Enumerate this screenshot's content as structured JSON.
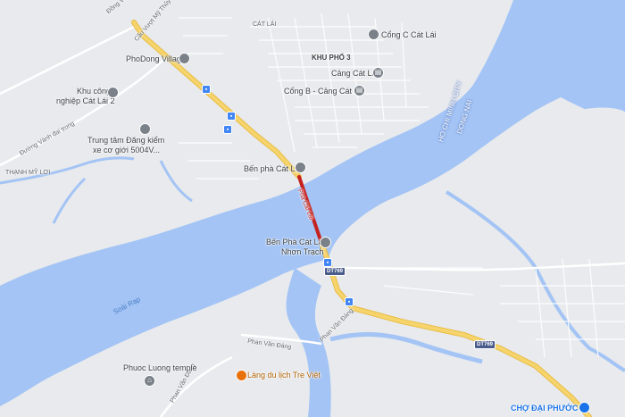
{
  "places": {
    "phodong_village": "PhoDong Village",
    "cat_lai": "CÁT LÁI",
    "khu_pho_3": "KHU PHỐ 3",
    "cong_c": "Cổng C Cát Lái",
    "cang_cat_lai": "Cảng Cát Lái",
    "cong_b": "Cổng B - Cảng Cát Lái",
    "khu_cong_nghiep_1": "Khu công",
    "khu_cong_nghiep_2": "nghiệp Cát Lái 2",
    "trung_tam_1": "Trung tâm Đăng kiểm",
    "trung_tam_2": "xe cơ giới 5004V...",
    "thanh_my_loi": "THẠNH MỸ LỢI",
    "ben_pha_cat_lai": "Bến phà Cát Lái",
    "pha_cat_lai": "Phà Cát Lái",
    "ben_pha_nhon_trach_1": "Bến Phà Cát Lái",
    "ben_pha_nhon_trach_2": "Nhơn Trạch",
    "hcm_city": "HO CHI MINH CITY",
    "dong_nai": "DONG NAI",
    "soai_rap": "Soài Rạp",
    "phan_van_dang_1": "Phan Văn Đáng",
    "phan_van_dang_2": "Phan Văn Đáng",
    "phuoc_luong": "Phuoc Luong temple",
    "lang_du_lich": "Làng du lịch Tre Việt",
    "cho_dai_phuoc": "CHỢ ĐẠI PHƯỚC",
    "dong_van_cong": "Đồng Văn Cống",
    "cau_vuot": "Cầu Vượt Mỹ Thủy",
    "duong_vanh_dai": "Đường Vành đai trong",
    "phan_van_dang_3": "Phan Văn Đáng"
  },
  "road_shields": {
    "dt769_a": "DT769",
    "dt769_b": "DT769"
  },
  "icons": {
    "pin": "map-pin-icon",
    "bus": "bus-stop-icon",
    "temple": "temple-icon",
    "museum": "port-icon"
  },
  "colors": {
    "water": "#a3c4f5",
    "land": "#e8eaed",
    "main_road": "#f6d46c",
    "ferry_route": "#c5221f",
    "minor_road": "#ffffff"
  }
}
